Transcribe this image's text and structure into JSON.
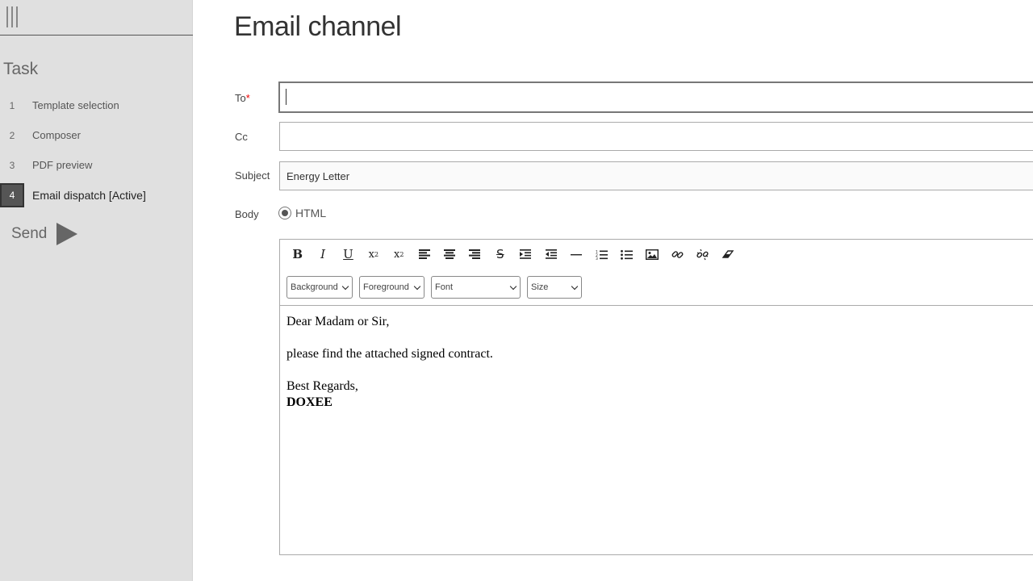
{
  "sidebar": {
    "task_title": "Task",
    "steps": [
      {
        "num": "1",
        "label": "Template selection"
      },
      {
        "num": "2",
        "label": "Composer"
      },
      {
        "num": "3",
        "label": "PDF preview"
      },
      {
        "num": "4",
        "label": "Email dispatch [Active]"
      }
    ],
    "send_label": "Send"
  },
  "main": {
    "title": "Email channel",
    "to_label": "To",
    "to_required": "*",
    "to_value": "",
    "cc_label": "Cc",
    "cc_value": "",
    "subject_label": "Subject",
    "subject_value": "Energy Letter",
    "body_label": "Body",
    "body_format": "HTML"
  },
  "editor": {
    "toolbar_icons": [
      "bold-icon",
      "italic-icon",
      "underline-icon",
      "subscript-icon",
      "superscript-icon",
      "align-left-icon",
      "align-center-icon",
      "align-right-icon",
      "strikethrough-icon",
      "indent-icon",
      "outdent-icon",
      "horizontal-rule-icon",
      "ordered-list-icon",
      "unordered-list-icon",
      "image-icon",
      "link-icon",
      "unlink-icon",
      "eraser-icon"
    ],
    "selects": {
      "background": "Background",
      "foreground": "Foreground",
      "font": "Font",
      "size": "Size"
    },
    "content": {
      "greeting": "Dear Madam or Sir,",
      "line1": "please find the attached signed contract.",
      "closing": "Best Regards,",
      "signature": "DOXEE"
    }
  }
}
